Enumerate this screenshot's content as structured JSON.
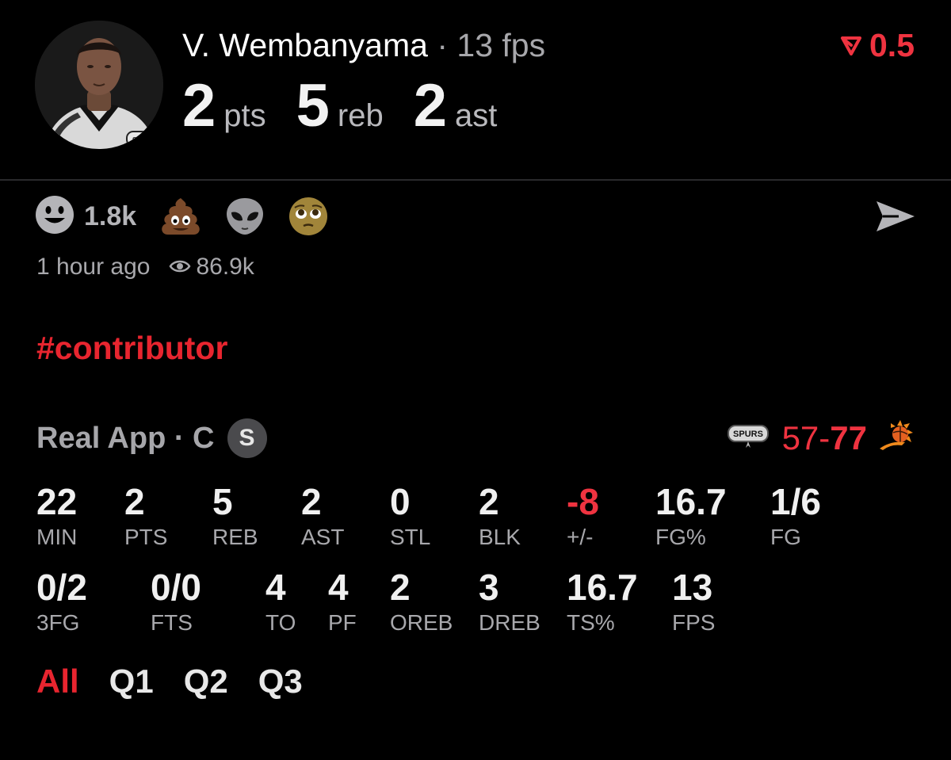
{
  "player": {
    "name": "V. Wembanyama",
    "fps_text": "13 fps",
    "stats": [
      {
        "value": "2",
        "label": "pts"
      },
      {
        "value": "5",
        "label": "reb"
      },
      {
        "value": "2",
        "label": "ast"
      }
    ]
  },
  "vote": {
    "value": "0.5",
    "color": "#ef3340",
    "icon": "down-arrow-icon"
  },
  "reactions": {
    "count": "1.8k",
    "items": [
      "smiley-face",
      "poop-emoji",
      "alien-emoji",
      "pleading-face-emoji"
    ]
  },
  "meta": {
    "time_ago": "1 hour ago",
    "views": "86.9k"
  },
  "hashtag": "#contributor",
  "source": {
    "name": "Real App · C",
    "badge": "S"
  },
  "game": {
    "home_score": "57",
    "separator": "-",
    "away_score": "77"
  },
  "stats_row1": [
    {
      "value": "22",
      "label": "MIN"
    },
    {
      "value": "2",
      "label": "PTS"
    },
    {
      "value": "5",
      "label": "REB"
    },
    {
      "value": "2",
      "label": "AST"
    },
    {
      "value": "0",
      "label": "STL"
    },
    {
      "value": "2",
      "label": "BLK"
    },
    {
      "value": "-8",
      "label": "+/-"
    },
    {
      "value": "16.7",
      "label": "FG%"
    },
    {
      "value": "1/6",
      "label": "FG"
    }
  ],
  "stats_row2": [
    {
      "value": "0/2",
      "label": "3FG"
    },
    {
      "value": "0/0",
      "label": "FTS"
    },
    {
      "value": "4",
      "label": "TO"
    },
    {
      "value": "4",
      "label": "PF"
    },
    {
      "value": "2",
      "label": "OREB"
    },
    {
      "value": "3",
      "label": "DREB"
    },
    {
      "value": "16.7",
      "label": "TS%"
    },
    {
      "value": "13",
      "label": "FPS"
    }
  ],
  "periods": [
    "All",
    "Q1",
    "Q2",
    "Q3"
  ],
  "colors": {
    "accent": "#e8252f",
    "background": "#000000",
    "muted": "#a8a8ac"
  }
}
